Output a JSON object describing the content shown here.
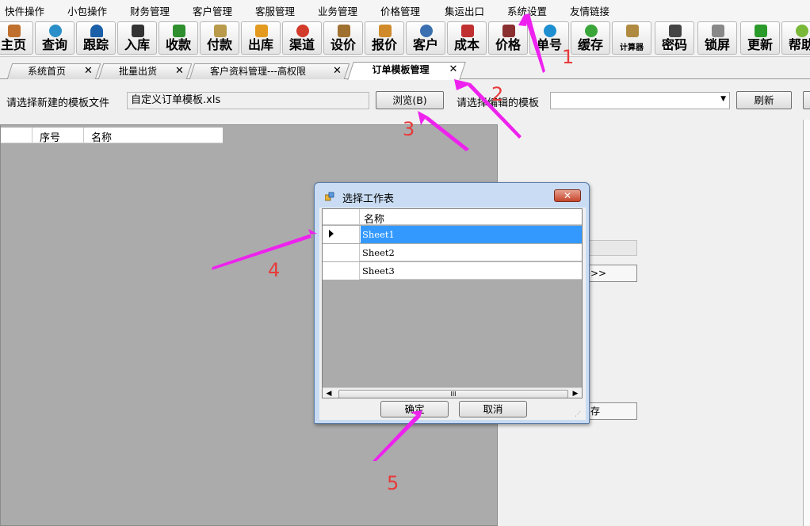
{
  "menu": [
    "快件操作",
    "小包操作",
    "财务管理",
    "客户管理",
    "客服管理",
    "业务管理",
    "价格管理",
    "集运出口",
    "系统设置",
    "友情链接"
  ],
  "toolbar": [
    {
      "label": "主页",
      "icon": "home-icon",
      "color": "#c0702e"
    },
    {
      "label": "查询",
      "icon": "magnifier-icon",
      "color": "#2a8fc8"
    },
    {
      "label": "跟踪",
      "icon": "wifi-icon",
      "color": "#1a5fa8"
    },
    {
      "label": "入库",
      "icon": "scanner-icon",
      "color": "#333333"
    },
    {
      "label": "收款",
      "icon": "yen-icon",
      "color": "#2f8f2f"
    },
    {
      "label": "付款",
      "icon": "money-icon",
      "color": "#b89a4a"
    },
    {
      "label": "出库",
      "icon": "envelope-icon",
      "color": "#e39a1f"
    },
    {
      "label": "渠道",
      "icon": "refresh-ring-icon",
      "color": "#d23a2a"
    },
    {
      "label": "设价",
      "icon": "scale-icon",
      "color": "#a07030"
    },
    {
      "label": "报价",
      "icon": "notepad-icon",
      "color": "#d08a2a"
    },
    {
      "label": "客户",
      "icon": "users-icon",
      "color": "#3a6fb0"
    },
    {
      "label": "成本",
      "icon": "bar-chart-icon",
      "color": "#c03030"
    },
    {
      "label": "价格",
      "icon": "price-tag-icon",
      "color": "#8a3030"
    },
    {
      "label": "单号",
      "icon": "eye-icon",
      "color": "#1f8fd0"
    },
    {
      "label": "缓存",
      "icon": "recycle-icon",
      "color": "#3aa63a"
    },
    {
      "label": "计算器",
      "icon": "calculator-icon",
      "color": "#b08a40"
    },
    {
      "label": "密码",
      "icon": "key-icon",
      "color": "#444444"
    },
    {
      "label": "锁屏",
      "icon": "lock-icon",
      "color": "#888888"
    },
    {
      "label": "更新",
      "icon": "download-arrow-icon",
      "color": "#2a9a2a"
    },
    {
      "label": "帮助",
      "icon": "help-icon",
      "color": "#7ab83a"
    }
  ],
  "tabs": [
    {
      "label": "系统首页"
    },
    {
      "label": "批量出货"
    },
    {
      "label": "客户资料管理---高权限"
    },
    {
      "label": "订单模板管理"
    }
  ],
  "template": {
    "new_file_label": "请选择新建的模板文件",
    "file_value": "自定义订单模板.xls",
    "browse_label": "浏览(B)",
    "edit_label": "请选择编辑的模板",
    "edit_value": "",
    "refresh_label": "刷新"
  },
  "grid": {
    "columns": [
      "序号",
      "名称"
    ]
  },
  "right_panel": {
    "arrow_button": ">>",
    "save_button_partial": "存"
  },
  "dialog": {
    "title": "选择工作表",
    "column": "名称",
    "rows": [
      "Sheet1",
      "Sheet2",
      "Sheet3"
    ],
    "selected_index": 0,
    "scroll_grip": "III",
    "ok_label": "确定",
    "cancel_label": "取消"
  },
  "annotations": [
    "1",
    "2",
    "3",
    "4",
    "5"
  ],
  "colors": {
    "annotation_arrow": "#ee22ee",
    "annotation_number": "#e83a3a",
    "selection": "#3399ff"
  }
}
